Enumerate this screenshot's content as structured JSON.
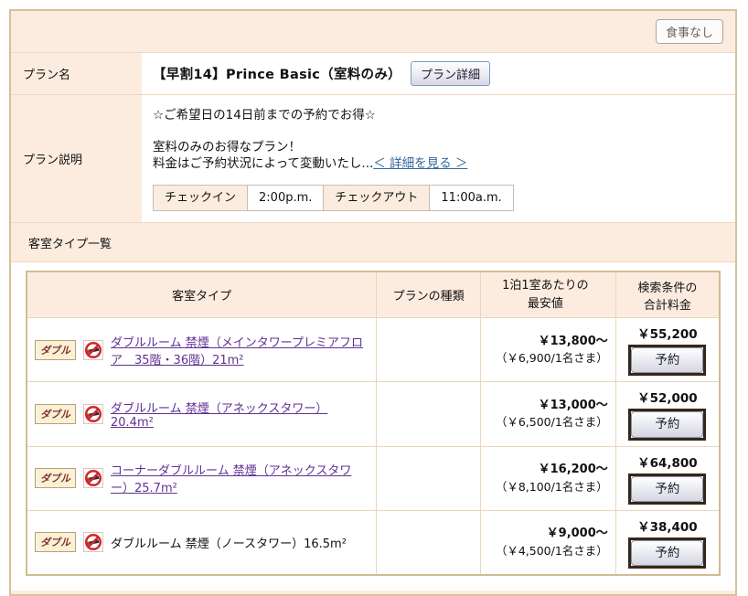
{
  "meal_badge": "食事なし",
  "plan": {
    "name_label": "プラン名",
    "name": "【早割14】Prince Basic（室料のみ）",
    "detail_button": "プラン詳細",
    "desc_label": "プラン説明",
    "desc_line1": "☆ご希望日の14日前までの予約でお得☆",
    "desc_line2": "室料のみのお得なプラン！",
    "desc_line3": "料金はご予約状況によって変動いたし...",
    "detail_link": "＜ 詳細を見る ＞",
    "checkin": {
      "label": "チェックイン",
      "time": "2:00p.m."
    },
    "checkout": {
      "label": "チェックアウト",
      "time": "11:00a.m."
    }
  },
  "rooms": {
    "section_title": "客室タイプ一覧",
    "columns": [
      "客室タイプ",
      "プランの種類",
      "1泊1室あたりの\n最安値",
      "検索条件の\n合計料金"
    ],
    "reserve_label": "予約",
    "rows": [
      {
        "badge": "ダブル",
        "name": "ダブルルーム 禁煙（メインタワープレミアフロア　35階・36階）21m²",
        "min_price": "￥13,800～",
        "per_person": "（￥6,900/1名さま）",
        "total": "￥55,200"
      },
      {
        "badge": "ダブル",
        "name": "ダブルルーム 禁煙（アネックスタワー）20.4m²",
        "min_price": "￥13,000～",
        "per_person": "（￥6,500/1名さま）",
        "total": "￥52,000"
      },
      {
        "badge": "ダブル",
        "name": "コーナーダブルルーム 禁煙（アネックスタワー）25.7m²",
        "min_price": "￥16,200～",
        "per_person": "（￥8,100/1名さま）",
        "total": "￥64,800"
      },
      {
        "badge": "ダブル",
        "name": "ダブルルーム 禁煙（ノースタワー）16.5m²",
        "min_price": "￥9,000～",
        "per_person": "（￥4,500/1名さま）",
        "total": "￥38,400"
      }
    ]
  },
  "colors": {
    "peach": "#fcecdf",
    "panel_border": "#d8c19b",
    "link_purple": "#5e3292",
    "link_blue": "#33659c",
    "badge_text": "#8b3026",
    "no_smoking_red": "#cc2a2a"
  }
}
